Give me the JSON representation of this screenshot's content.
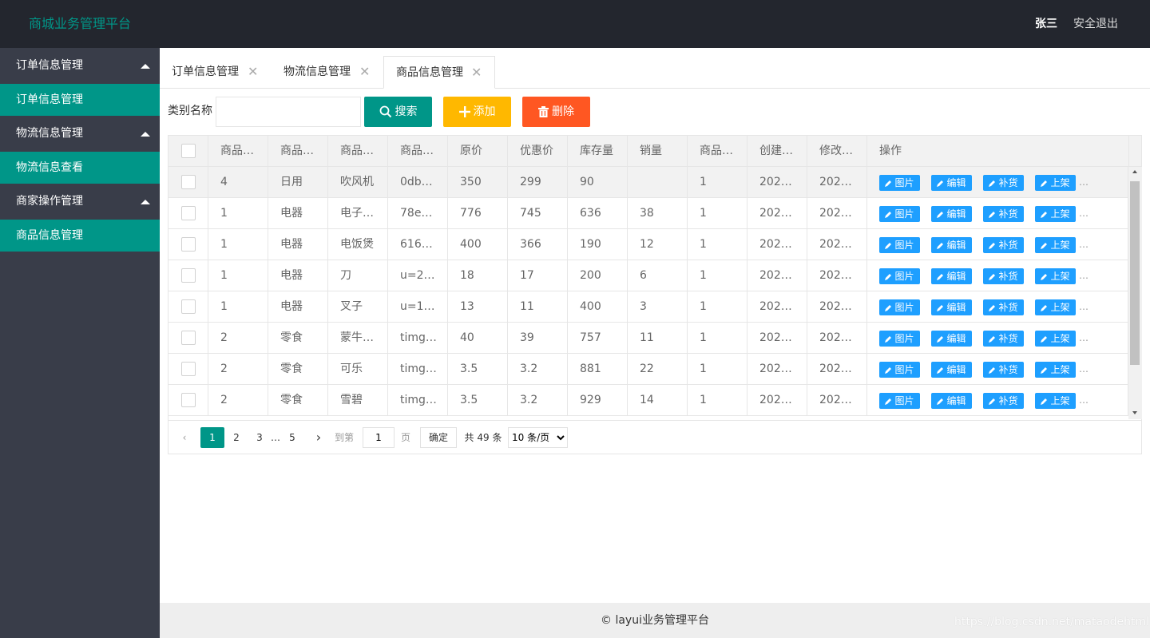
{
  "header": {
    "logo": "商城业务管理平台",
    "user": "张三",
    "logout": "安全退出"
  },
  "sidebar": {
    "groups": [
      {
        "label": "订单信息管理",
        "child": "订单信息管理"
      },
      {
        "label": "物流信息管理",
        "child": "物流信息查看"
      },
      {
        "label": "商家操作管理",
        "child": "商品信息管理"
      }
    ]
  },
  "tabs": [
    {
      "label": "订单信息管理",
      "close": "✕"
    },
    {
      "label": "物流信息管理",
      "close": "✕"
    },
    {
      "label": "商品信息管理",
      "close": "✕"
    }
  ],
  "toolbar": {
    "label": "类别名称",
    "input_value": "",
    "search": "搜索",
    "add": "添加",
    "delete": "删除"
  },
  "table": {
    "headers": [
      "商品…",
      "商品…",
      "商品…",
      "商品…",
      "原价",
      "优惠价",
      "库存量",
      "销量",
      "商品…",
      "创建…",
      "修改…",
      "操作"
    ],
    "rows": [
      [
        "4",
        "日用",
        "吹风机",
        "0db…",
        "350",
        "299",
        "90",
        "",
        "1",
        "202…",
        "202…"
      ],
      [
        "1",
        "电器",
        "电子…",
        "78e…",
        "776",
        "745",
        "636",
        "38",
        "1",
        "202…",
        "202…"
      ],
      [
        "1",
        "电器",
        "电饭煲",
        "616…",
        "400",
        "366",
        "190",
        "12",
        "1",
        "202…",
        "202…"
      ],
      [
        "1",
        "电器",
        "刀",
        "u=2…",
        "18",
        "17",
        "200",
        "6",
        "1",
        "202…",
        "202…"
      ],
      [
        "1",
        "电器",
        "叉子",
        "u=1…",
        "13",
        "11",
        "400",
        "3",
        "1",
        "202…",
        "202…"
      ],
      [
        "2",
        "零食",
        "蒙牛…",
        "timg…",
        "40",
        "39",
        "757",
        "11",
        "1",
        "202…",
        "202…"
      ],
      [
        "2",
        "零食",
        "可乐",
        "timg…",
        "3.5",
        "3.2",
        "881",
        "22",
        "1",
        "202…",
        "202…"
      ],
      [
        "2",
        "零食",
        "雪碧",
        "timg…",
        "3.5",
        "3.2",
        "929",
        "14",
        "1",
        "202…",
        "202…"
      ]
    ],
    "actions": [
      "图片",
      "编辑",
      "补货",
      "上架"
    ],
    "more": "…"
  },
  "pager": {
    "pages": [
      "1",
      "2",
      "3",
      "…",
      "5"
    ],
    "current": "1",
    "goto_label": "到第",
    "goto_value": "1",
    "page_unit": "页",
    "confirm": "确定",
    "total": "共 49 条",
    "per_page": "10 条/页"
  },
  "footer": {
    "text": "© layui业务管理平台"
  },
  "watermark": "https://blog.csdn.net/mataodehtml",
  "colors": {
    "header_bg": "#23262e",
    "sidebar_bg": "#393d49",
    "accent": "#009688",
    "add": "#ffb800",
    "delete": "#ff5722",
    "op_button": "#1e9fff"
  }
}
